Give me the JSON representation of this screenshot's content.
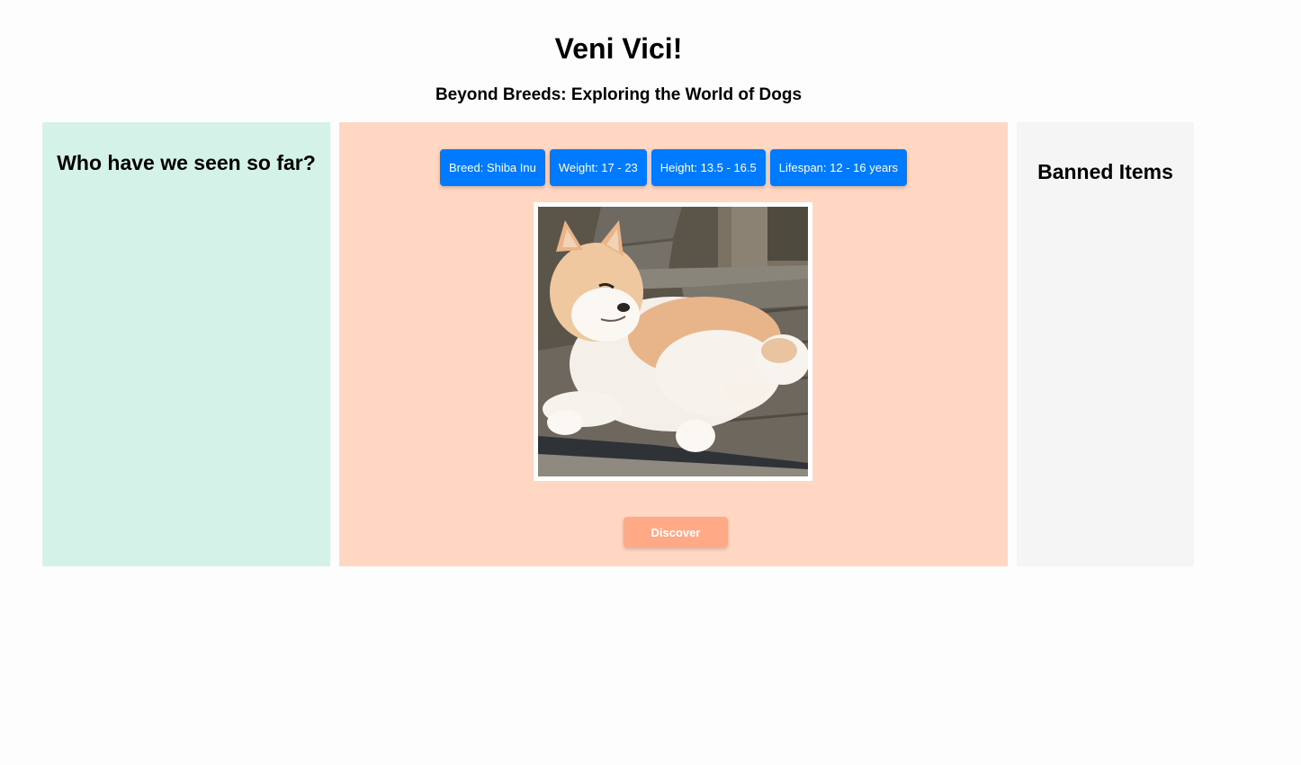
{
  "header": {
    "title": "Veni Vici!",
    "subtitle": "Beyond Breeds: Exploring the World of Dogs"
  },
  "history": {
    "heading": "Who have we seen so far?"
  },
  "main": {
    "attributes": [
      {
        "label": "Breed: Shiba Inu"
      },
      {
        "label": "Weight: 17 - 23"
      },
      {
        "label": "Height: 13.5 - 16.5"
      },
      {
        "label": "Lifespan: 12 - 16 years"
      }
    ],
    "image": {
      "icon": "shiba-inu-dog-photo"
    },
    "discover_label": "Discover"
  },
  "banned": {
    "heading": "Banned Items"
  },
  "colors": {
    "history_bg": "#d4f2e8",
    "main_bg": "#ffd7c3",
    "banned_bg": "#f5f5f5",
    "attribute_button": "#007bff",
    "discover_button": "#ffa987"
  }
}
